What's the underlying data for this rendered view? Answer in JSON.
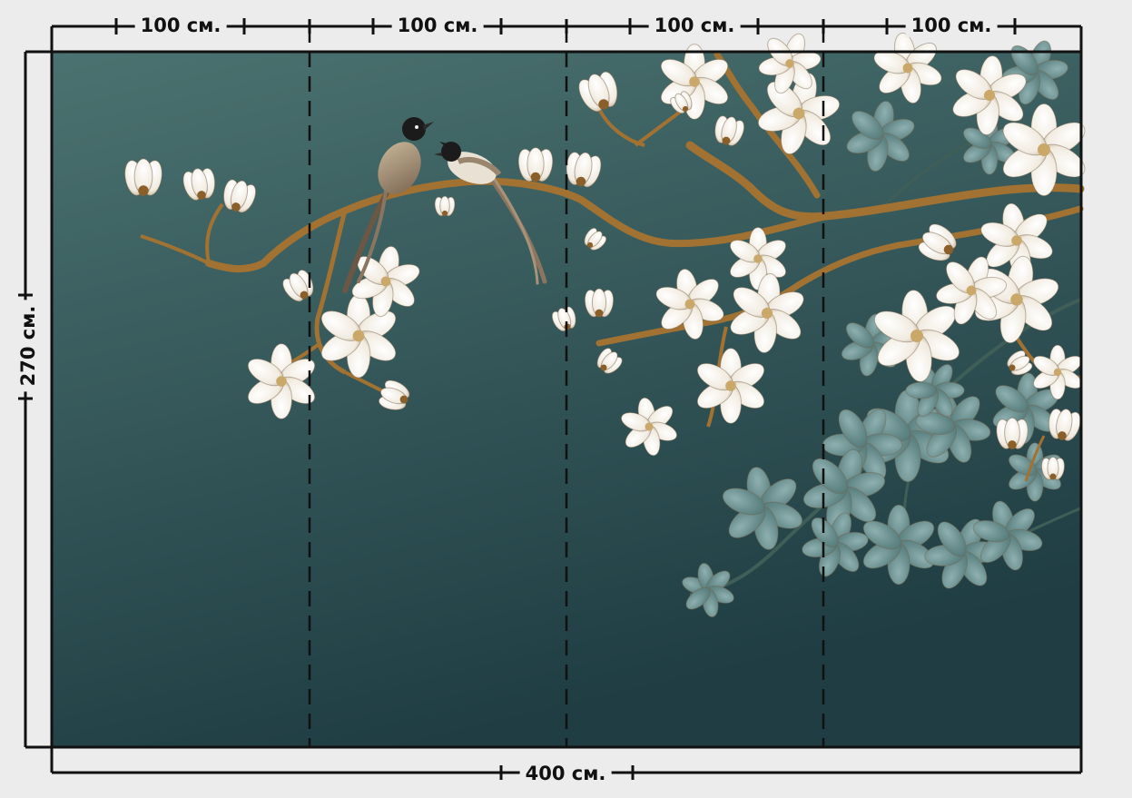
{
  "dimensions": {
    "panel_widths": [
      "100 см.",
      "100 см.",
      "100 см.",
      "100 см."
    ],
    "total_width": "400 см.",
    "height": "270 см."
  },
  "colors": {
    "wall_top": "#4b7270",
    "wall_bottom": "#1f3d43",
    "blossom": "#f4efe6",
    "blossom_shade": "#b9a68a",
    "muted_blossom": "#6f9596",
    "branch": "#a27232",
    "guide_lines": "#111111",
    "frame_background": "#ececec"
  },
  "artwork": {
    "panel_count": 4,
    "motif": [
      "magnolia-branches",
      "two-birds"
    ]
  }
}
